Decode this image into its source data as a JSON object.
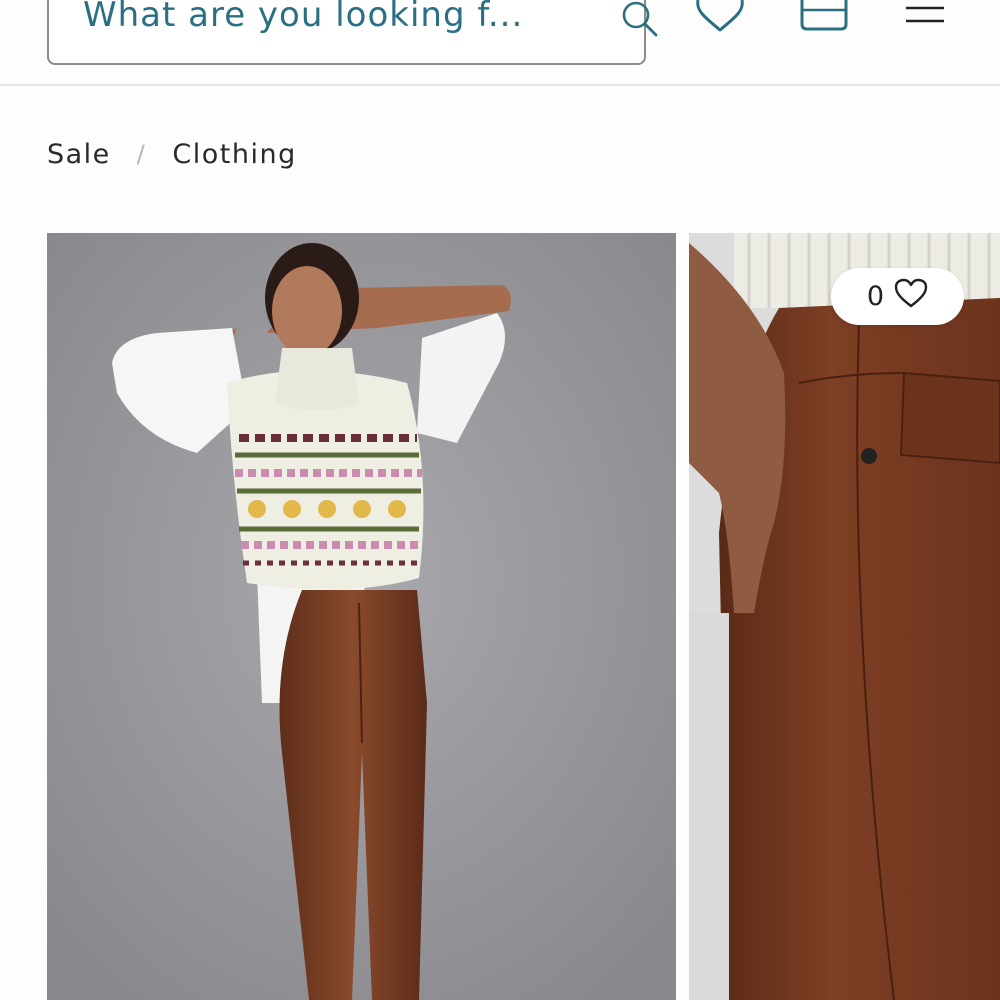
{
  "header": {
    "search": {
      "placeholder": "What are you looking f..."
    },
    "icons": {
      "search": "search-icon",
      "wishlist": "heart-icon",
      "bag": "shopping-bag-icon",
      "menu": "hamburger-menu-icon"
    }
  },
  "breadcrumb": {
    "items": [
      "Sale",
      "Clothing"
    ],
    "separator": "/"
  },
  "products": [
    {
      "image": "model-in-fair-isle-vest-white-shirt-brown-coated-jeans"
    },
    {
      "image": "close-up-brown-coated-jeans-pocket",
      "wishlist_count": "0"
    }
  ],
  "colors": {
    "accent": "#2b6f82",
    "text": "#2a2a2a",
    "background": "#fdfdfb"
  }
}
